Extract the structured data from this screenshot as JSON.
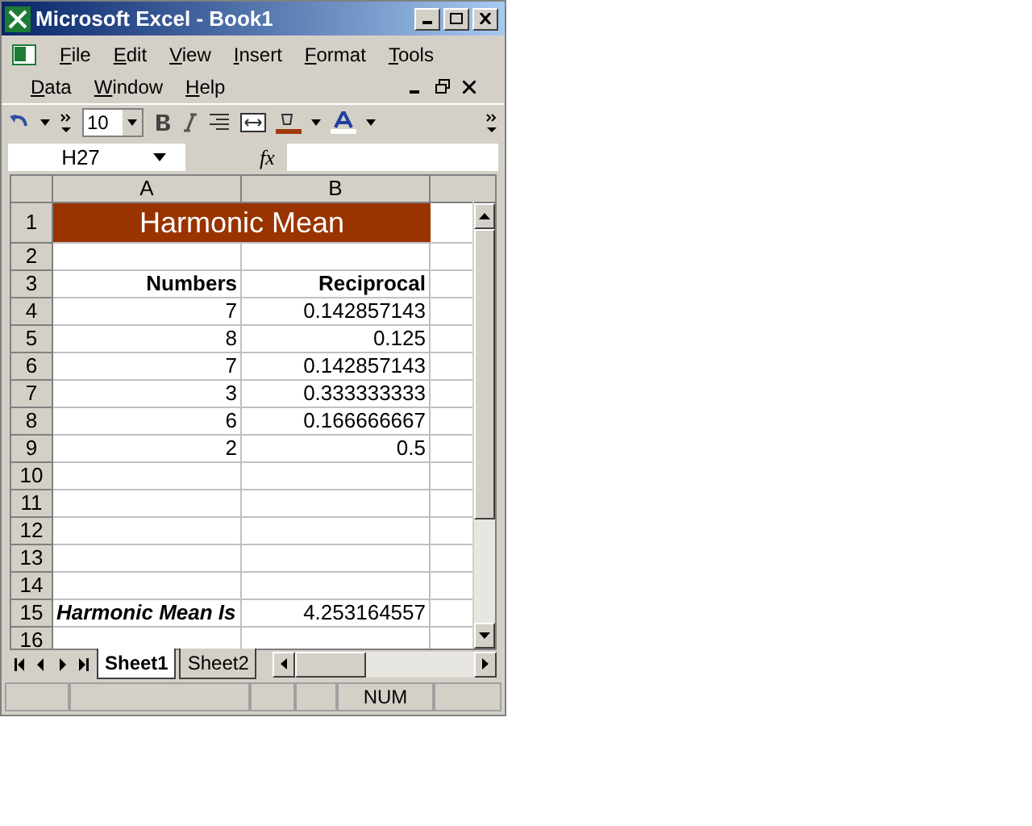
{
  "window": {
    "title": "Microsoft Excel - Book1"
  },
  "menu_rows": [
    [
      {
        "label": "File"
      },
      {
        "label": "Edit"
      },
      {
        "label": "View"
      },
      {
        "label": "Insert"
      },
      {
        "label": "Format"
      },
      {
        "label": "Tools"
      }
    ],
    [
      {
        "label": "Data"
      },
      {
        "label": "Window"
      },
      {
        "label": "Help"
      }
    ]
  ],
  "toolbar": {
    "font_size": "10"
  },
  "formula_bar": {
    "name_box": "H27",
    "fx": "fx"
  },
  "columns": [
    "A",
    "B"
  ],
  "rows": [
    {
      "number": "1",
      "kind": "title",
      "cells": [
        "Harmonic Mean"
      ]
    },
    {
      "number": "2",
      "kind": "plain",
      "cells": [
        "",
        ""
      ]
    },
    {
      "number": "3",
      "kind": "header",
      "cells": [
        "Numbers",
        "Reciprocal"
      ]
    },
    {
      "number": "4",
      "kind": "plain",
      "cells": [
        "7",
        "0.142857143"
      ]
    },
    {
      "number": "5",
      "kind": "plain",
      "cells": [
        "8",
        "0.125"
      ]
    },
    {
      "number": "6",
      "kind": "plain",
      "cells": [
        "7",
        "0.142857143"
      ]
    },
    {
      "number": "7",
      "kind": "plain",
      "cells": [
        "3",
        "0.333333333"
      ]
    },
    {
      "number": "8",
      "kind": "plain",
      "cells": [
        "6",
        "0.166666667"
      ]
    },
    {
      "number": "9",
      "kind": "plain",
      "cells": [
        "2",
        "0.5"
      ]
    },
    {
      "number": "10",
      "kind": "plain",
      "cells": [
        "",
        ""
      ]
    },
    {
      "number": "11",
      "kind": "plain",
      "cells": [
        "",
        ""
      ]
    },
    {
      "number": "12",
      "kind": "plain",
      "cells": [
        "",
        ""
      ]
    },
    {
      "number": "13",
      "kind": "plain",
      "cells": [
        "",
        ""
      ]
    },
    {
      "number": "14",
      "kind": "plain",
      "cells": [
        "",
        ""
      ]
    },
    {
      "number": "15",
      "kind": "result",
      "cells": [
        "Harmonic Mean Is",
        "4.253164557"
      ]
    },
    {
      "number": "16",
      "kind": "plain",
      "cells": [
        "",
        ""
      ]
    }
  ],
  "sheet_tabs": [
    {
      "label": "Sheet1",
      "selected": true
    },
    {
      "label": "Sheet2",
      "selected": false
    }
  ],
  "status_bar": {
    "indicator": "NUM"
  }
}
